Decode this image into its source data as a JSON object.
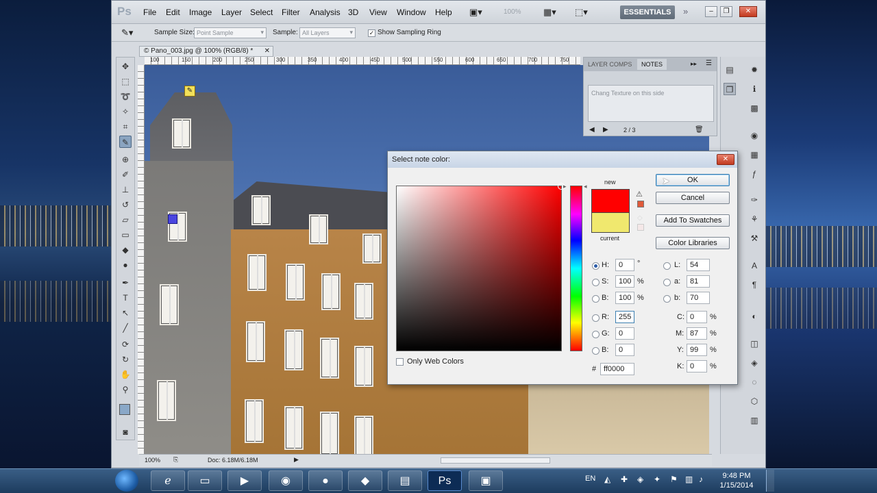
{
  "menu": [
    "File",
    "Edit",
    "Image",
    "Layer",
    "Select",
    "Filter",
    "Analysis",
    "3D",
    "View",
    "Window",
    "Help"
  ],
  "app_logo": "Ps",
  "zoom_display": "100%",
  "workspace_button": "ESSENTIALS",
  "options_bar": {
    "sample_size_label": "Sample Size:",
    "sample_size_value": "Point Sample",
    "sample_label": "Sample:",
    "sample_value": "All Layers",
    "show_ring_label": "Show Sampling Ring"
  },
  "document": {
    "tab_title": "© Pano_003.jpg @ 100% (RGB/8) *",
    "ruler_ticks": [
      "100",
      "150",
      "200",
      "250",
      "300",
      "350",
      "400",
      "450",
      "500",
      "550",
      "600",
      "650",
      "700",
      "750"
    ],
    "status_zoom": "100%",
    "status_doc": "Doc: 6.18M/6.18M"
  },
  "notes_panel": {
    "tabs": [
      "LAYER COMPS",
      "NOTES"
    ],
    "note_text": "Chang Texture on this side",
    "page_indicator": "2 / 3"
  },
  "color_dialog": {
    "title": "Select note color:",
    "new_label": "new",
    "current_label": "current",
    "buttons": {
      "ok": "OK",
      "cancel": "Cancel",
      "add_to_swatches": "Add To Swatches",
      "color_libraries": "Color Libraries"
    },
    "only_web_colors": "Only Web Colors",
    "fields": {
      "H": {
        "label": "H:",
        "value": "0",
        "unit": "°"
      },
      "S": {
        "label": "S:",
        "value": "100",
        "unit": "%"
      },
      "Bv": {
        "label": "B:",
        "value": "100",
        "unit": "%"
      },
      "R": {
        "label": "R:",
        "value": "255"
      },
      "G": {
        "label": "G:",
        "value": "0"
      },
      "Bc": {
        "label": "B:",
        "value": "0"
      },
      "L": {
        "label": "L:",
        "value": "54"
      },
      "a": {
        "label": "a:",
        "value": "81"
      },
      "b": {
        "label": "b:",
        "value": "70"
      },
      "C": {
        "label": "C:",
        "value": "0",
        "unit": "%"
      },
      "M": {
        "label": "M:",
        "value": "87",
        "unit": "%"
      },
      "Y": {
        "label": "Y:",
        "value": "99",
        "unit": "%"
      },
      "K": {
        "label": "K:",
        "value": "0",
        "unit": "%"
      }
    },
    "hex_label": "#",
    "hex_value": "ff0000",
    "new_color": "#ff0000",
    "current_color": "#f0e86e"
  },
  "taskbar": {
    "language": "EN",
    "time": "9:48 PM",
    "date": "1/15/2014"
  }
}
